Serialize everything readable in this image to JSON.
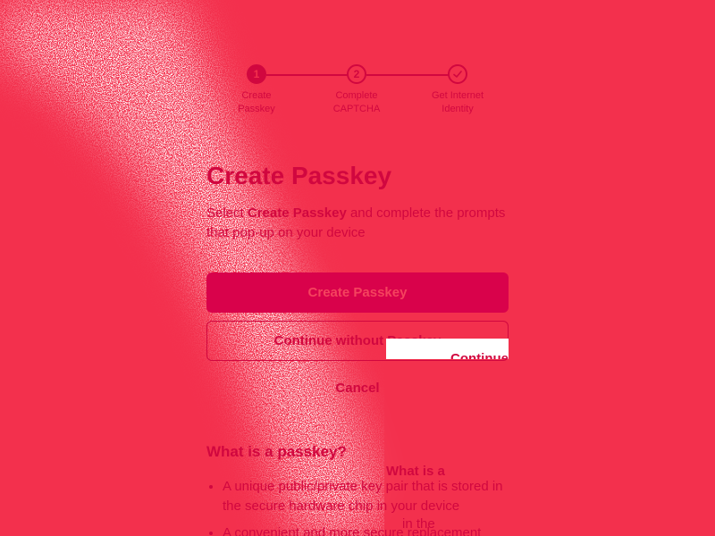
{
  "stepper": {
    "steps": [
      {
        "number": "1",
        "label_line1": "Create",
        "label_line2": "Passkey",
        "state": "active"
      },
      {
        "number": "2",
        "label_line1": "Complete",
        "label_line2": "CAPTCHA",
        "state": "pending"
      },
      {
        "number": "",
        "label_line1": "Get Internet",
        "label_line2": "Identity",
        "state": "pending",
        "icon": "check-icon"
      }
    ]
  },
  "main": {
    "title": "Create Passkey",
    "desc_prefix": "Select",
    "desc_bold": "Create Passkey",
    "desc_suffix": "and complete the prompts that pop-up on your device",
    "primary_button": "Create Passkey",
    "secondary_button": "Continue without Passkey",
    "cancel_link": "Cancel"
  },
  "info": {
    "heading": "What is a passkey?",
    "bullets": [
      "A unique public/private key pair that is stored in the secure hardware chip in your device",
      "A convenient and more secure replacement"
    ]
  },
  "ghost": {
    "overlay_label": "Continue",
    "heading_fragment": "What is a",
    "line_fragment": "in the"
  },
  "colors": {
    "background": "#f3304d",
    "accent": "#d1073f",
    "primary_button_bg": "#d9024b"
  }
}
